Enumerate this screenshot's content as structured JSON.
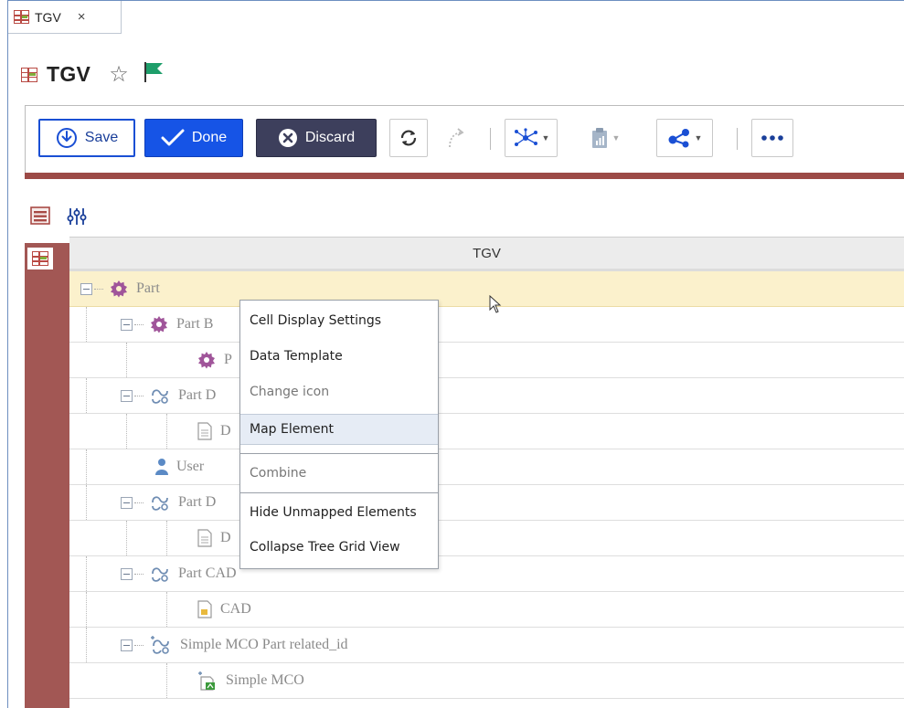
{
  "tab": {
    "label": "TGV",
    "close": "×"
  },
  "title": {
    "text": "TGV"
  },
  "toolbar": {
    "save_label": "Save",
    "done_label": "Done",
    "discard_label": "Discard"
  },
  "grid": {
    "column_header": "TGV"
  },
  "tree": [
    {
      "label": "Part",
      "icon": "gear-icon"
    },
    {
      "label": "Part B",
      "icon": "gear-icon"
    },
    {
      "label": "P",
      "icon": "gear-icon"
    },
    {
      "label": "Part D",
      "icon": "relationship-icon"
    },
    {
      "label": "D",
      "icon": "document-icon"
    },
    {
      "label": "User",
      "icon": "user-icon"
    },
    {
      "label": "Part D",
      "icon": "relationship-icon"
    },
    {
      "label": "D",
      "icon": "document-icon"
    },
    {
      "label": "Part CAD",
      "icon": "relationship-icon"
    },
    {
      "label": "CAD",
      "icon": "cad-file-icon"
    },
    {
      "label": "Simple MCO Part related_id",
      "icon": "relationship-icon"
    },
    {
      "label": "Simple MCO",
      "icon": "mco-icon"
    }
  ],
  "context_menu": {
    "items": [
      {
        "label": "Cell Display Settings",
        "enabled": true
      },
      {
        "label": "Data Template",
        "enabled": true
      },
      {
        "label": "Change icon",
        "enabled": false
      },
      {
        "label": "Map Element",
        "enabled": true,
        "hovered": true
      },
      {
        "label": "Combine",
        "enabled": false
      },
      {
        "label": "Hide Unmapped Elements",
        "enabled": true
      },
      {
        "label": "Collapse Tree Grid View",
        "enabled": true
      }
    ]
  },
  "colors": {
    "accent_blue": "#1654e6",
    "discard_dark": "#3d3f5c",
    "sidebar_red": "#a25754",
    "selected_row": "#fbf1cc",
    "flag_green": "#1e9e6a"
  }
}
